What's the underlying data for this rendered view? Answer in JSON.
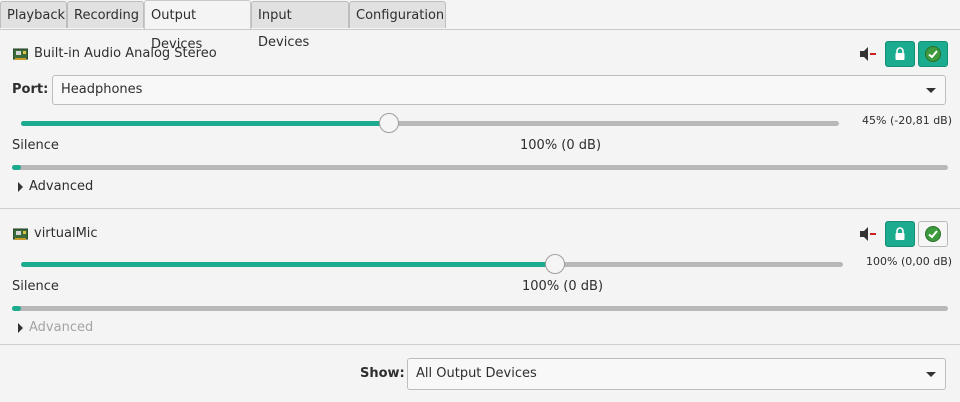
{
  "tabs": [
    {
      "label": "Playback",
      "active": false
    },
    {
      "label": "Recording",
      "active": false
    },
    {
      "label": "Output Devices",
      "active": true
    },
    {
      "label": "Input Devices",
      "active": false
    },
    {
      "label": "Configuration",
      "active": false
    }
  ],
  "devices": [
    {
      "name": "Built-in Audio Analog Stereo",
      "port_label": "Port:",
      "port_value": "Headphones",
      "volume_fraction": 0.45,
      "volume_text": "45% (-20,81 dB)",
      "silence_label": "Silence",
      "reference_label": "100% (0 dB)",
      "peak_fraction": 0.01,
      "advanced_label": "Advanced",
      "lock_active": true,
      "default_active": true
    },
    {
      "name": "virtualMic",
      "volume_fraction": 0.65,
      "volume_text": "100% (0,00 dB)",
      "silence_label": "Silence",
      "reference_label": "100% (0 dB)",
      "peak_fraction": 0.01,
      "advanced_label": "Advanced",
      "lock_active": true,
      "default_active": false
    }
  ],
  "footer": {
    "show_label": "Show:",
    "show_value": "All Output Devices"
  },
  "colors": {
    "accent": "#1bab8f",
    "mute_accent": "#cc2222",
    "track": "#b8b8b8"
  },
  "icons": {
    "sound_card": "sound-card-icon",
    "mute": "speaker-mute-icon",
    "lock": "lock-icon",
    "default": "checkmark-icon"
  }
}
